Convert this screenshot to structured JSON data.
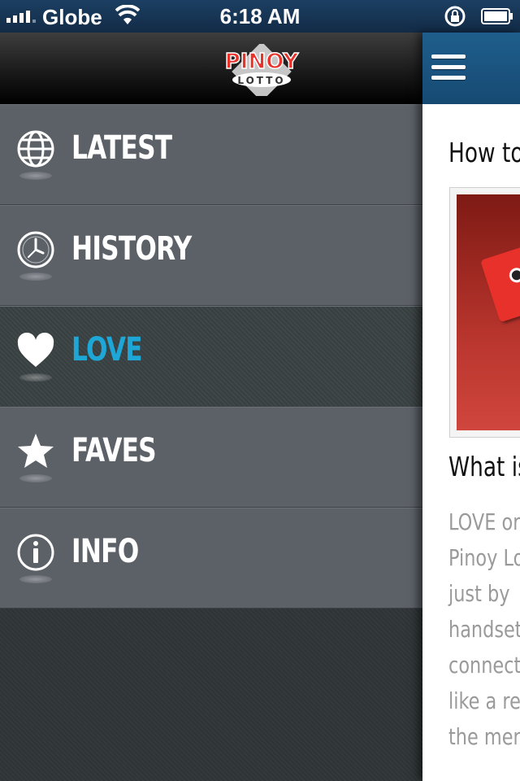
{
  "status_bar": {
    "carrier": "Globe",
    "time": "6:18 AM"
  },
  "drawer": {
    "logo_alt": "PINOY LOTTO",
    "items": [
      {
        "label": "LATEST",
        "icon": "globe-icon",
        "active": false
      },
      {
        "label": "HISTORY",
        "icon": "clock-icon",
        "active": false
      },
      {
        "label": "LOVE",
        "icon": "heart-icon",
        "active": true
      },
      {
        "label": "FAVES",
        "icon": "star-icon",
        "active": false
      },
      {
        "label": "INFO",
        "icon": "info-icon",
        "active": false
      }
    ],
    "active_color": "#1ea7d6"
  },
  "content": {
    "title": "How to",
    "subtitle": "What is",
    "body_lines": [
      "LOVE or",
      "Pinoy Lo",
      "just by",
      "handset",
      "connect",
      "like a re",
      "the men"
    ]
  },
  "colors": {
    "header_blue": "#1f5e8c",
    "menu_gray": "#5c6168",
    "active_bg": "#3a4142"
  }
}
